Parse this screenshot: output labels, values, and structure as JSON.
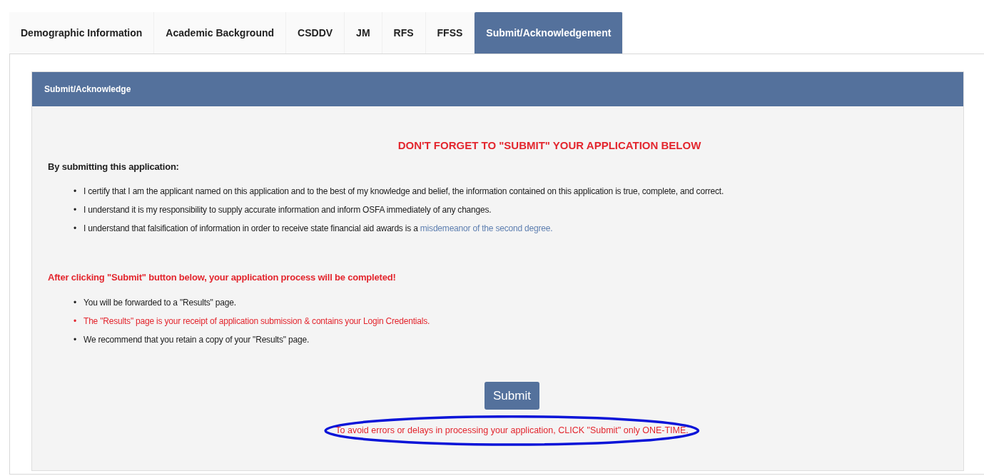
{
  "tabs": [
    {
      "label": "Demographic Information",
      "selected": false
    },
    {
      "label": "Academic Background",
      "selected": false
    },
    {
      "label": "CSDDV",
      "selected": false
    },
    {
      "label": "JM",
      "selected": false
    },
    {
      "label": "RFS",
      "selected": false
    },
    {
      "label": "FFSS",
      "selected": false
    },
    {
      "label": "Submit/Acknowledgement",
      "selected": true
    }
  ],
  "panel": {
    "title": "Submit/Acknowledge",
    "notice": "DON'T FORGET TO \"SUBMIT\" YOUR APPLICATION BELOW",
    "intro": "By submitting this application:",
    "certifications": [
      {
        "marker": "•",
        "text": "I certify that I am the applicant named on this application and to the best of my knowledge and belief, the information contained on this application is true, complete, and correct."
      },
      {
        "marker": "•",
        "text": "I understand it is my responsibility to supply accurate information and inform OSFA immediately of any changes."
      },
      {
        "marker": "•",
        "text": "I understand that falsification of information in order to receive state financial aid awards is a",
        "link": "misdemeanor of the second degree."
      }
    ],
    "after_heading": "After clicking \"Submit\" button below, your application process will be completed!",
    "after_items": [
      {
        "marker": "•",
        "text": "You will be forwarded to a \"Results\" page.",
        "warning": false
      },
      {
        "marker": "•",
        "text": "The \"Results\" page is your receipt of application submission & contains your Login Credentials.",
        "warning": true
      },
      {
        "marker": "•",
        "text": "We recommend that you retain a copy of your \"Results\" page.",
        "warning": false
      }
    ],
    "submit_button": "Submit",
    "footer_warning": "To avoid errors or delays in processing your application, CLICK \"Submit\" only ONE-TIME."
  }
}
